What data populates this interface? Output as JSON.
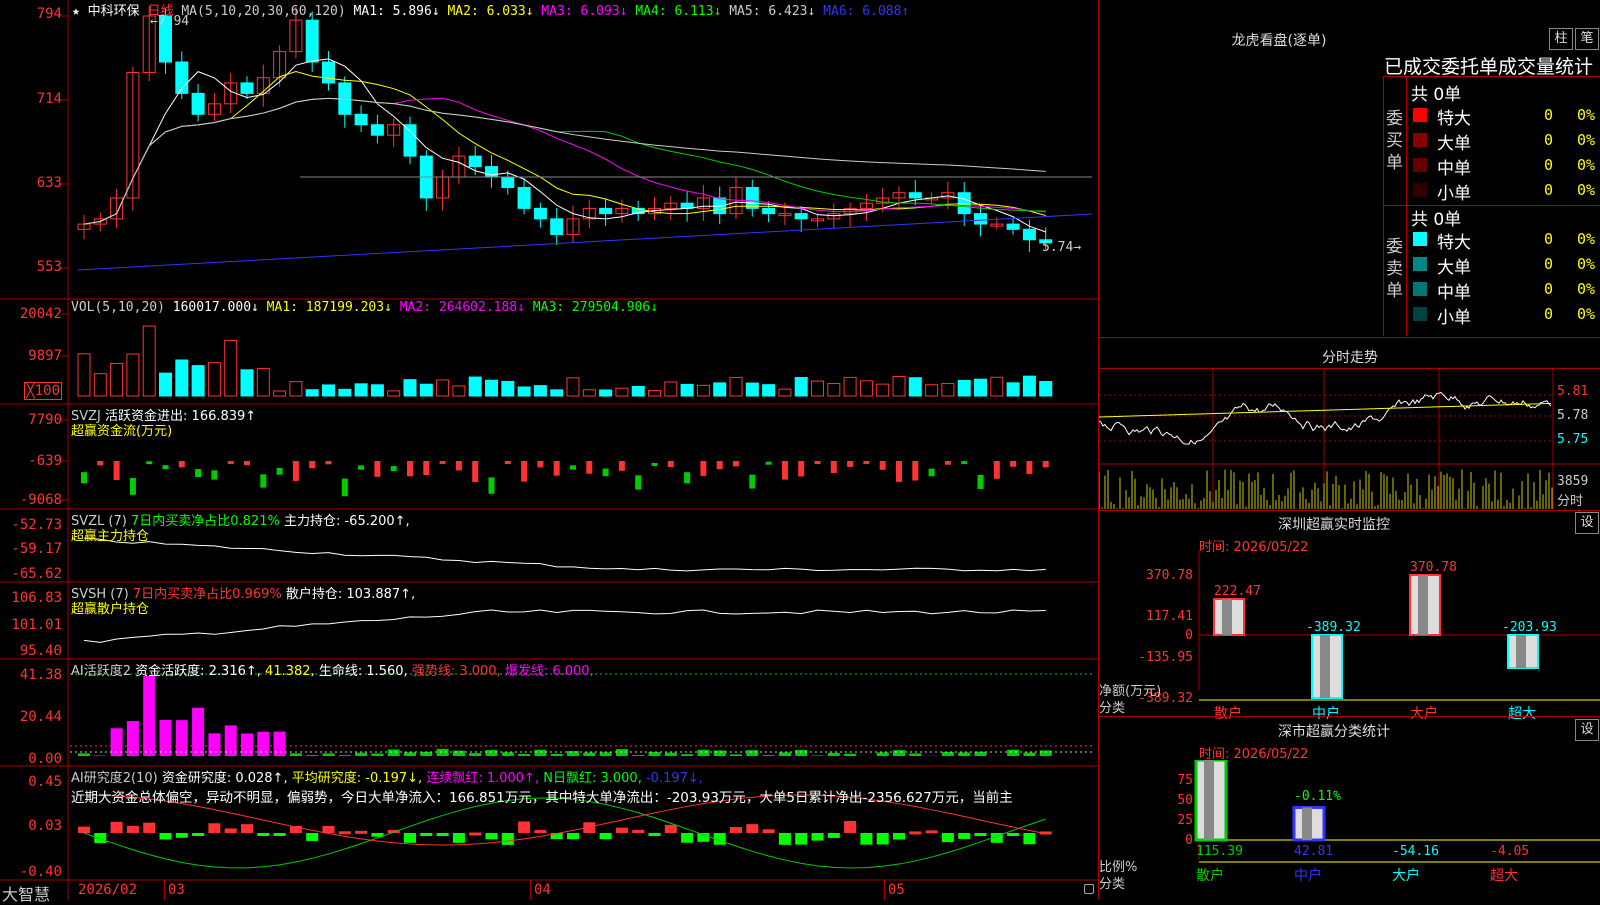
{
  "stock": {
    "name": "中科环保",
    "period": "日线"
  },
  "main_header": {
    "ma_label": "MA(5,10,20,30,60,120)",
    "ma1": "MA1: 5.896↓",
    "ma2": "MA2: 6.033↓",
    "ma3": "MA3: 6.093↓",
    "ma4": "MA4: 6.113↓",
    "ma5": "MA5: 6.423↓",
    "ma6": "MA6: 6.088↑",
    "high_mark": "7.94",
    "low_mark": "5.74"
  },
  "main_axis": [
    "794",
    "714",
    "633",
    "553"
  ],
  "vol_header": {
    "label": "VOL(5,10,20)",
    "val": "160017.000↓",
    "ma1": "MA1: 187199.203↓",
    "ma2": "MA2: 264602.188↓",
    "ma3": "MA3: 279504.906↓"
  },
  "vol_axis": [
    "20042",
    "9897",
    "╳100"
  ],
  "svzj_header": {
    "label": "SVZJ",
    "text": "活跃资金进出: 166.839↑",
    "sub": "超赢资金流(万元)"
  },
  "svzj_axis": [
    "7790",
    "-639",
    "-9068"
  ],
  "svzl_header": {
    "label": "SVZL (7)",
    "text": "7日内买卖净占比0.821%",
    "text2": "主力持仓: -65.200↑,",
    "sub": "超赢主力持仓"
  },
  "svzl_axis": [
    "-52.73",
    "-59.17",
    "-65.62"
  ],
  "svsh_header": {
    "label": "SVSH (7)",
    "text": "7日内买卖净占比0.969%",
    "text2": "散户持仓: 103.887↑,",
    "sub": "超赢散户持仓"
  },
  "svsh_axis": [
    "106.83",
    "101.01",
    "95.40"
  ],
  "ai_header": {
    "label": "AI活跃度2",
    "t1": "资金活跃度: 2.316↑,",
    "t2": "41.382,",
    "t3": "生命线: 1.560,",
    "t4": "强势线: 3.000,",
    "t5": "爆发线: 6.000,"
  },
  "ai_axis": [
    "41.38",
    "20.44",
    "0.00"
  ],
  "air_header": {
    "label": "AI研究度2(10)",
    "t1": "资金研究度: 0.028↑,",
    "t2": "平均研究度: -0.197↓,",
    "t3": "连续飘红: 1.000↑,",
    "t4": "N日飘红: 3.000,",
    "t5": "-0.197↓,"
  },
  "air_text": "近期大资金总体偏空，异动不明显，偏弱势，今日大单净流入：166.851万元，其中特大单净流出：-203.93万元，大单5日累计净出-2356.627万元，当前主",
  "air_axis": [
    "0.45",
    "0.03",
    "-0.40"
  ],
  "date_axis": {
    "brand": "大智慧",
    "d1": "2026/02",
    "d2": "03",
    "d3": "04",
    "d4": "05"
  },
  "dragon": {
    "title": "龙虎看盘(逐单)",
    "btn1": "柱",
    "btn2": "笔",
    "subtitle": "已成交委托单成交量统计",
    "buy_label": "委买单",
    "sell_label": "委卖单",
    "buy_total": "共 0单",
    "sell_total": "共 0单",
    "rows": [
      {
        "name": "特大",
        "v": "0",
        "p": "0%"
      },
      {
        "name": "大单",
        "v": "0",
        "p": "0%"
      },
      {
        "name": "中单",
        "v": "0",
        "p": "0%"
      },
      {
        "name": "小单",
        "v": "0",
        "p": "0%"
      }
    ]
  },
  "intraday": {
    "title": "分时走势",
    "axis": [
      "5.81",
      "5.78",
      "5.75"
    ],
    "vol": "3859",
    "vol_label": "分时"
  },
  "monitor": {
    "title": "深圳超赢实时监控",
    "btn": "设",
    "time": "时间: 2026/05/22",
    "axis": [
      "370.78",
      "117.41",
      "0",
      "-135.95",
      "-389.32"
    ],
    "ylabel": "净额(万元)",
    "xlabel": "分类",
    "cats": [
      "散户",
      "中户",
      "大户",
      "超大"
    ],
    "values": [
      222.47,
      -389.32,
      370.78,
      -203.93
    ],
    "labels": [
      "222.47",
      "-389.32",
      "370.78",
      "-203.93"
    ]
  },
  "classstat": {
    "title": "深市超赢分类统计",
    "btn": "设",
    "time": "时间: 2026/05/22",
    "axis": [
      "75",
      "50",
      "25",
      "0"
    ],
    "ylabel": "比例%",
    "xlabel": "分类",
    "top_label": "-0.11%",
    "cats": [
      "散户",
      "中户",
      "大户",
      "超大"
    ],
    "values": [
      115.39,
      42.81,
      -54.16,
      -4.05
    ],
    "labels": [
      "115.39",
      "42.81",
      "-54.16",
      "-4.05"
    ]
  },
  "chart_data": {
    "type": "bar",
    "title": "深圳超赢实时监控",
    "ylabel": "净额(万元)",
    "categories": [
      "散户",
      "中户",
      "大户",
      "超大"
    ],
    "values": [
      222.47,
      -389.32,
      370.78,
      -203.93
    ],
    "ylim": [
      -389.32,
      370.78
    ]
  }
}
